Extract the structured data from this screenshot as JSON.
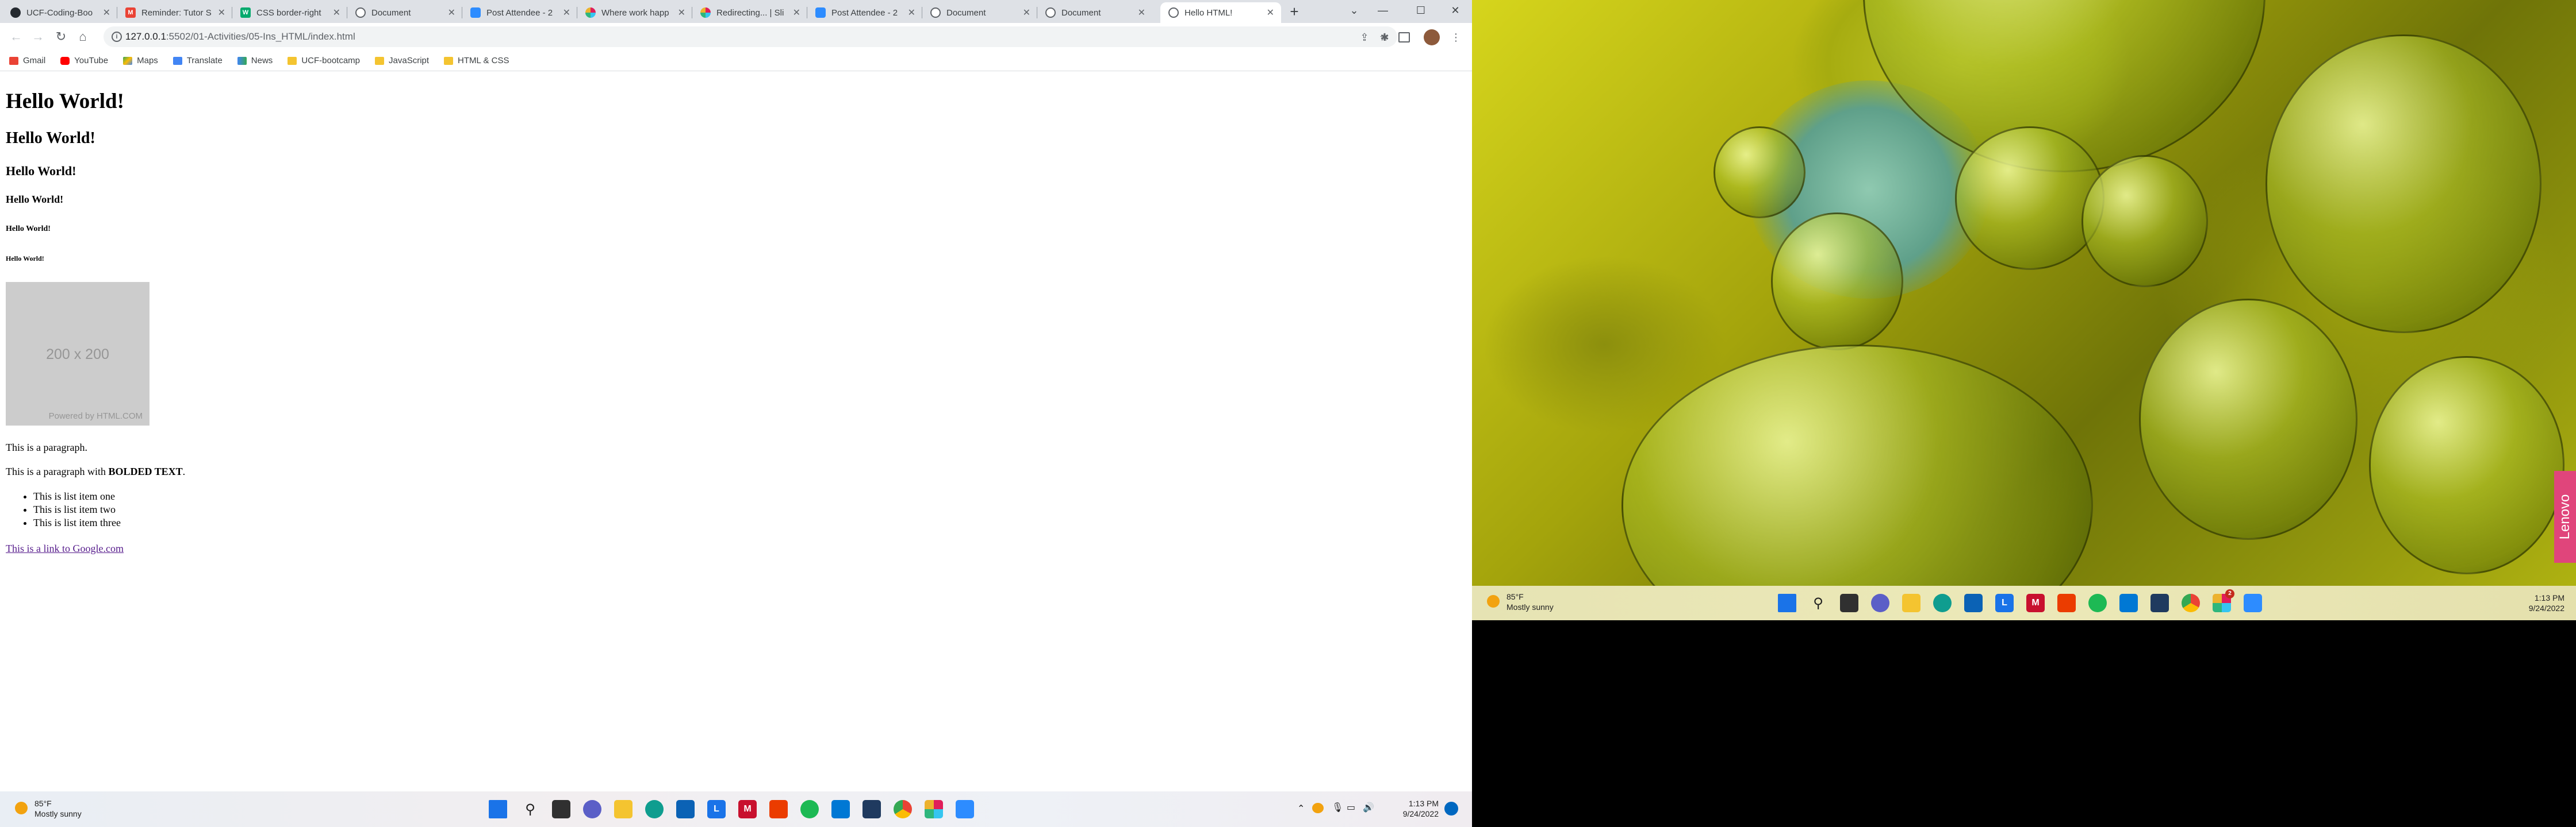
{
  "browser": {
    "tabs": [
      {
        "title": "UCF-Coding-Boo",
        "icon": "github-icon"
      },
      {
        "title": "Reminder: Tutor S",
        "icon": "gmail-icon"
      },
      {
        "title": "CSS border-right",
        "icon": "w3schools-icon"
      },
      {
        "title": "Document",
        "icon": "globe-icon"
      },
      {
        "title": "Post Attendee - 2",
        "icon": "zoom-icon"
      },
      {
        "title": "Where work happ",
        "icon": "slack-icon"
      },
      {
        "title": "Redirecting... | Sli",
        "icon": "slack-icon"
      },
      {
        "title": "Post Attendee - 2",
        "icon": "zoom-icon"
      },
      {
        "title": "Document",
        "icon": "globe-icon"
      },
      {
        "title": "Document",
        "icon": "globe-icon"
      },
      {
        "title": "Hello HTML!",
        "icon": "globe-icon",
        "active": true
      }
    ],
    "new_tab": "+",
    "window_controls": {
      "dropdown": "⌄",
      "minimize": "—",
      "maximize": "☐",
      "close": "✕"
    },
    "url_host": "127.0.0.1",
    "url_path": ":5502/01-Activities/05-Ins_HTML/index.html",
    "bookmarks": [
      {
        "label": "Gmail",
        "color": "#ea4335"
      },
      {
        "label": "YouTube",
        "color": "#ff0000"
      },
      {
        "label": "Maps",
        "color": "#34a853"
      },
      {
        "label": "Translate",
        "color": "#4285f4"
      },
      {
        "label": "News",
        "color": "#4285f4"
      },
      {
        "label": "UCF-bootcamp",
        "color": "#f4c430"
      },
      {
        "label": "JavaScript",
        "color": "#f4c430"
      },
      {
        "label": "HTML & CSS",
        "color": "#f4c430"
      }
    ]
  },
  "page": {
    "h1": "Hello World!",
    "h2": "Hello World!",
    "h3": "Hello World!",
    "h4": "Hello World!",
    "h5": "Hello World!",
    "h6": "Hello World!",
    "image_dimensions": "200 x 200",
    "image_credit": "Powered by HTML.COM",
    "paragraph": "This is a paragraph.",
    "paragraph_with_bold_prefix": "This is a paragraph with ",
    "bold_text": "BOLDED TEXT",
    "paragraph_suffix": ".",
    "list_items": [
      "This is list item one",
      "This is list item two",
      "This is list item three"
    ],
    "link": "This is a link to Google.com"
  },
  "taskbar_left": {
    "temperature": "85°F",
    "condition": "Mostly sunny",
    "time": "1:13 PM",
    "date": "9/24/2022"
  },
  "taskbar_right": {
    "temperature": "85°F",
    "condition": "Mostly sunny",
    "time": "1:13 PM",
    "date": "9/24/2022",
    "notification_count": "2"
  },
  "wallpaper": {
    "brand": "Lenovo"
  }
}
